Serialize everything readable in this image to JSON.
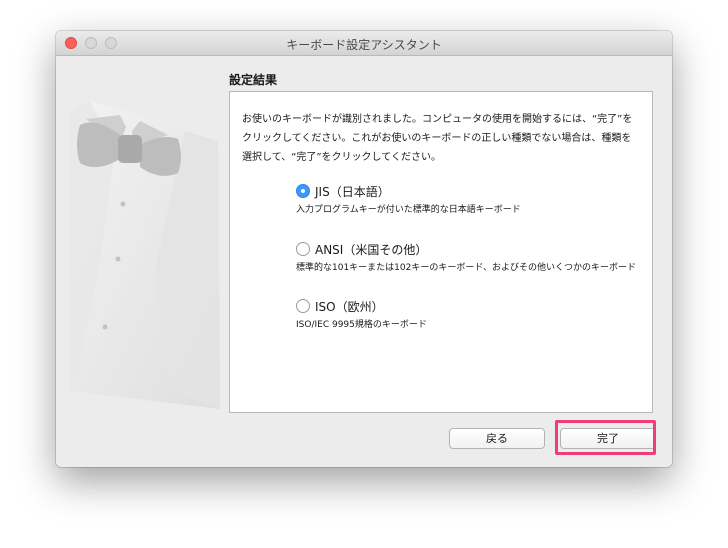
{
  "window": {
    "title": "キーボード設定アシスタント"
  },
  "section_title": "設定結果",
  "intro_text": "お使いのキーボードが識別されました。コンピュータの使用を開始するには、“完了”をクリックしてください。これがお使いのキーボードの正しい種類でない場合は、種類を選択して、“完了”をクリックしてください。",
  "options": [
    {
      "label": "JIS（日本語）",
      "description": "入力プログラムキーが付いた標準的な日本語キーボード",
      "selected": true
    },
    {
      "label": "ANSI（米国その他）",
      "description": "標準的な101キーまたは102キーのキーボード、およびその他いくつかのキーボード",
      "selected": false
    },
    {
      "label": "ISO（欧州）",
      "description": "ISO/IEC 9995規格のキーボード",
      "selected": false
    }
  ],
  "buttons": {
    "back": "戻る",
    "done": "完了"
  },
  "colors": {
    "radio_selected": "#3b99fc",
    "highlight": "#ee3e79",
    "close_button": "#fc605b"
  },
  "icons": {
    "illustration": "tuxedo-bowtie-illustration"
  }
}
